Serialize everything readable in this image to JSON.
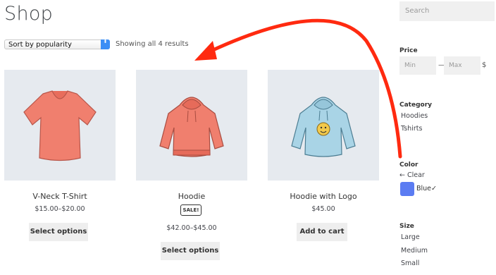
{
  "page": {
    "title": "Shop"
  },
  "toolbar": {
    "sort_selected": "Sort by popularity",
    "sort_arrow": "⬍",
    "result_count": "Showing all 4 results"
  },
  "products": [
    {
      "name": "V-Neck T-Shirt",
      "price": "$15.00–$20.00",
      "button": "Select options",
      "icon": "vneck-tshirt-image",
      "color": "#f07f6e"
    },
    {
      "name": "Hoodie",
      "badge": "SALE!",
      "price": "$42.00–$45.00",
      "button": "Select options",
      "icon": "hoodie-image",
      "color": "#f07f6e"
    },
    {
      "name": "Hoodie with Logo",
      "price": "$45.00",
      "button": "Add to cart",
      "icon": "hoodie-with-logo-image",
      "color": "#a9d4e6"
    }
  ],
  "sidebar": {
    "search_placeholder": "Search",
    "price": {
      "title": "Price",
      "min_placeholder": "Min",
      "separator": "—",
      "max_placeholder": "Max",
      "currency": "$"
    },
    "category": {
      "title": "Category",
      "items": [
        "Hoodies",
        "Tshirts"
      ]
    },
    "color": {
      "title": "Color",
      "clear": "← Clear",
      "selected": "Blue",
      "check": "✓",
      "swatch_color": "#5b7cf2"
    },
    "size": {
      "title": "Size",
      "items": [
        "Large",
        "Medium",
        "Small"
      ]
    }
  },
  "annotation": {
    "arrow_color": "#ff2a10",
    "icon": "red-curved-arrow-icon"
  }
}
